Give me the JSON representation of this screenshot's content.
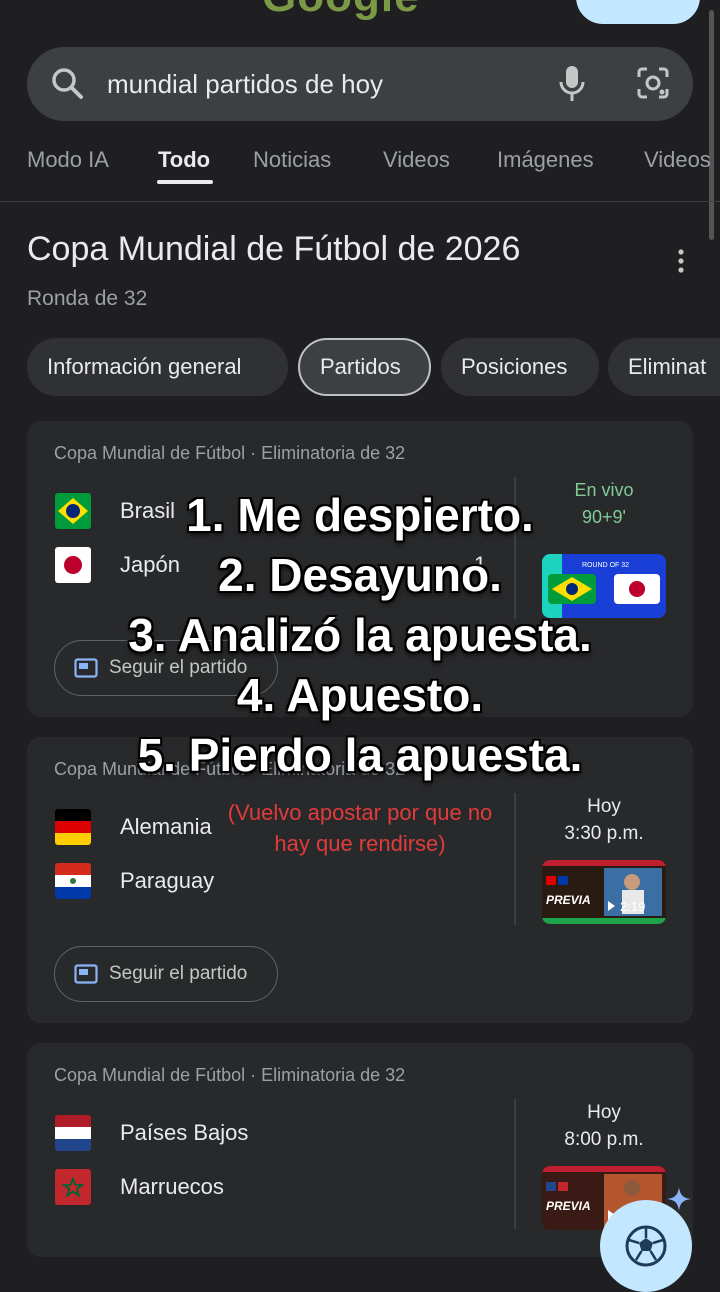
{
  "search": {
    "query": "mundial partidos de hoy"
  },
  "tabs": [
    "Modo IA",
    "Todo",
    "Noticias",
    "Videos",
    "Imágenes",
    "Videos"
  ],
  "heading": {
    "title": "Copa Mundial de Fútbol de 2026",
    "subtitle": "Ronda de 32"
  },
  "chips": [
    "Información general",
    "Partidos",
    "Posiciones",
    "Eliminat"
  ],
  "matches": [
    {
      "competition": "Copa Mundial de Fútbol · Eliminatoria de 32",
      "home": "Brasil",
      "away": "Japón",
      "away_score": "1",
      "status_line1": "En vivo",
      "status_line2": "90+9'",
      "thumb_label": "ROUND OF 32",
      "follow": "Seguir el partido"
    },
    {
      "competition": "Copa Mundial de Fútbol · Eliminatoria de 32",
      "home": "Alemania",
      "away": "Paraguay",
      "status_line1": "Hoy",
      "status_line2": "3:30 p.m.",
      "thumb_label": "PREVIA",
      "thumb_duration": "2:19",
      "follow": "Seguir el partido"
    },
    {
      "competition": "Copa Mundial de Fútbol · Eliminatoria de 32",
      "home": "Países Bajos",
      "away": "Marruecos",
      "status_line1": "Hoy",
      "status_line2": "8:00 p.m.",
      "thumb_label": "PREVIA"
    }
  ],
  "overlay": {
    "lines": [
      "1. Me despierto.",
      "2. Desayuno.",
      "3. Analizó la apuesta.",
      "4. Apuesto.",
      "5. Pierdo la apuesta."
    ],
    "note_line1": "(Vuelvo apostar por que no",
    "note_line2": "hay que rendirse)"
  },
  "colors": {
    "background": "#1f1f21",
    "card": "#28292b",
    "live": "#81c995",
    "overlay_note": "#e23b3b",
    "accent": "#c2e7ff"
  },
  "icons": [
    "search-icon",
    "mic-icon",
    "lens-icon",
    "more-vert-icon",
    "follow-icon",
    "soccer-ball-icon",
    "sparkle-icon"
  ]
}
